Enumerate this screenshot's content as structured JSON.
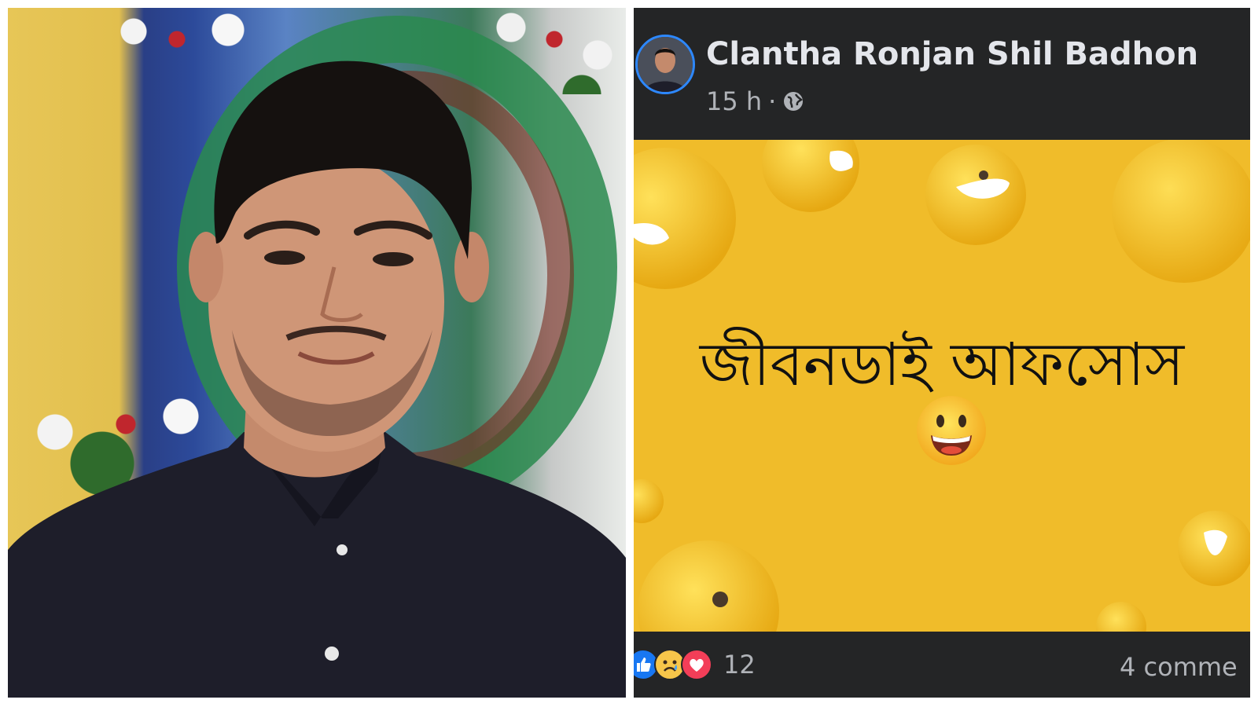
{
  "post": {
    "author_name": "Clantha Ronjan Shil Badhon",
    "time": "15 h",
    "separator": "·",
    "privacy_icon": "globe-icon",
    "image_text": "জীবনডাই আফসোস",
    "image_emoji": "grinning-face-emoji",
    "reactions": [
      "like-icon",
      "sad-icon",
      "love-icon"
    ],
    "reaction_count": "12",
    "comments_count": "4 comme"
  },
  "colors": {
    "dark_bg": "#18191a",
    "card_bg": "#242526",
    "name_text": "#e4e6eb",
    "meta_text": "#b0b3b8",
    "image_bg": "#f0bc2a",
    "avatar_ring": "#2d88ff"
  }
}
